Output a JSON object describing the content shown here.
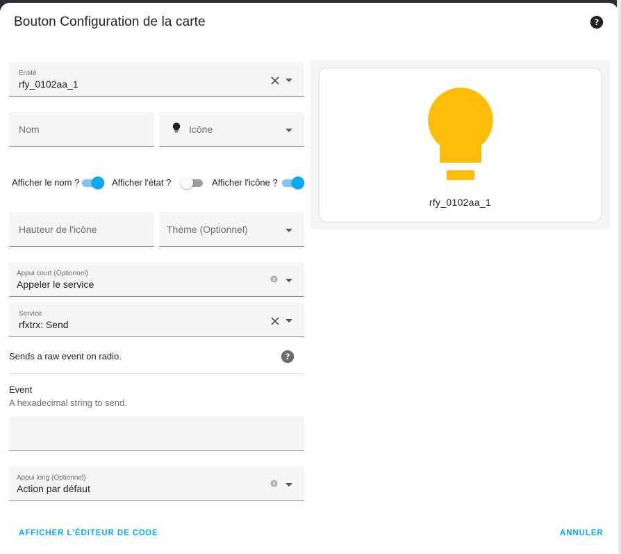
{
  "dialog": {
    "title": "Bouton Configuration de la carte"
  },
  "entity": {
    "label": "Entité",
    "value": "rfy_0102aa_1"
  },
  "name_field": {
    "placeholder": "Nom"
  },
  "icon_field": {
    "placeholder": "Icône"
  },
  "toggles": [
    {
      "label": "Afficher le nom ?",
      "on": true
    },
    {
      "label": "Afficher l'état ?",
      "on": false
    },
    {
      "label": "Afficher l'icône ?",
      "on": true
    }
  ],
  "icon_height_field": {
    "placeholder": "Hauteur de l'icône"
  },
  "theme_field": {
    "placeholder": "Thème (Optionnel)"
  },
  "tap_action": {
    "label": "Appui court (Optionnel)",
    "value": "Appeler le service"
  },
  "service": {
    "label": "Service",
    "value": "rfxtrx: Send"
  },
  "service_description": "Sends a raw event on radio.",
  "event": {
    "title": "Event",
    "description": "A hexadecimal string to send.",
    "value": ""
  },
  "hold_action": {
    "label": "Appui long (Optionnel)",
    "value": "Action par défaut"
  },
  "preview": {
    "entity_name": "rfy_0102aa_1",
    "icon": "lightbulb-icon",
    "icon_color": "#fdbd0a"
  },
  "footer": {
    "code_editor_label": "AFFICHER L'ÉDITEUR DE CODE",
    "cancel_label": "ANNULER"
  },
  "colors": {
    "accent": "#03a9f4",
    "field_bg": "#f5f5f5"
  }
}
